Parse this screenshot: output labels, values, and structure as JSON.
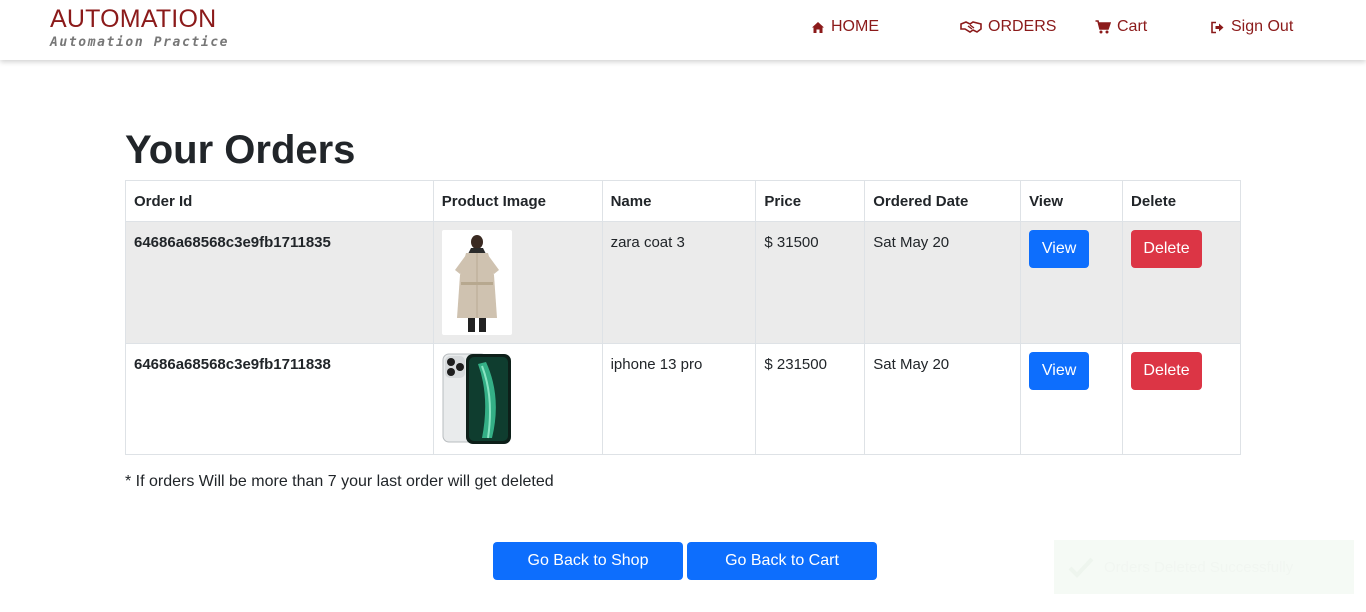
{
  "brand": {
    "title": "AUTOMATION",
    "subtitle": "Automation Practice"
  },
  "nav": {
    "home": {
      "label": "HOME",
      "icon": "home-icon"
    },
    "orders": {
      "label": "ORDERS",
      "icon": "handshake-icon"
    },
    "cart": {
      "label": "Cart",
      "icon": "cart-icon"
    },
    "signout": {
      "label": "Sign Out",
      "icon": "sign-out-icon"
    }
  },
  "page": {
    "title": "Your Orders"
  },
  "table": {
    "headers": [
      "Order Id",
      "Product Image",
      "Name",
      "Price",
      "Ordered Date",
      "View",
      "Delete"
    ],
    "rows": [
      {
        "order_id": "64686a68568c3e9fb1711835",
        "name": "zara coat 3",
        "price": "$ 31500",
        "date": "Sat May 20",
        "view": "View",
        "delete": "Delete",
        "image": "coat-product-image"
      },
      {
        "order_id": "64686a68568c3e9fb1711838",
        "name": "iphone 13 pro",
        "price": "$ 231500",
        "date": "Sat May 20",
        "view": "View",
        "delete": "Delete",
        "image": "phone-product-image"
      }
    ]
  },
  "note": "* If orders Will be more than 7 your last order will get deleted",
  "buttons": {
    "back_to_shop": "Go Back to Shop",
    "back_to_cart": "Go Back to Cart"
  },
  "toast": {
    "message": "Orders Deleted Successfully",
    "icon": "check-icon"
  },
  "colors": {
    "brand": "#8b1a1a",
    "primary": "#0d6efd",
    "danger": "#dc3545",
    "stripe": "#ebebeb"
  }
}
